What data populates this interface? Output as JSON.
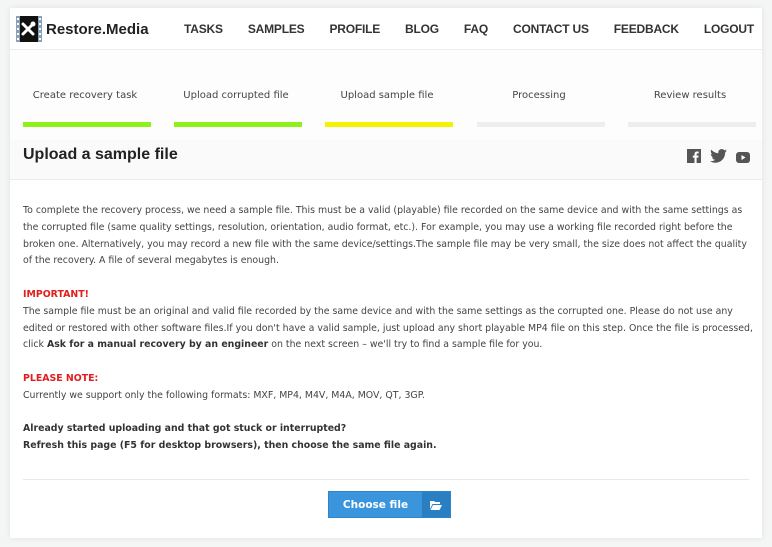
{
  "header": {
    "logo_icon": "film-tools-icon",
    "brand": "Restore.Media",
    "nav": [
      {
        "label": "TASKS"
      },
      {
        "label": "SAMPLES"
      },
      {
        "label": "PROFILE"
      },
      {
        "label": "BLOG"
      },
      {
        "label": "FAQ"
      },
      {
        "label": "CONTACT US"
      },
      {
        "label": "FEEDBACK"
      },
      {
        "label": "LOGOUT"
      }
    ]
  },
  "steps": [
    {
      "label": "Create recovery task",
      "status": "done",
      "color": "#8ef21a"
    },
    {
      "label": "Upload corrupted file",
      "status": "done",
      "color": "#8ef21a"
    },
    {
      "label": "Upload sample file",
      "status": "current",
      "color": "#f5f200"
    },
    {
      "label": "Processing",
      "status": "pending",
      "color": "#eeeeee"
    },
    {
      "label": "Review results",
      "status": "pending",
      "color": "#eeeeee"
    }
  ],
  "title_row": {
    "title": "Upload a sample file",
    "social": [
      "facebook-icon",
      "twitter-icon",
      "youtube-icon"
    ]
  },
  "content": {
    "intro": "To complete the recovery process, we need a sample file. This must be a valid (playable) file recorded on the same device and with the same settings as the corrupted file (same quality settings, resolution, orientation, audio format, etc.). For example, you may use a working file recorded right before the broken one. Alternatively, you may record a new file with the same device/settings.The sample file may be very small, the size does not affect the quality of the recovery. A file of several megabytes is enough.",
    "important_heading": "IMPORTANT!",
    "important_text_1": "The sample file must be an original and valid file recorded by the same device and with the same settings as the corrupted one. Please do not use any edited or restored with other software files.If you don't have a valid sample, just upload any short playable MP4 file on this step. Once the file is processed, click ",
    "important_bold": "Ask for a manual recovery by an engineer",
    "important_text_2": " on the next screen – we'll try to find a sample file for you.",
    "note_heading": "PLEASE NOTE:",
    "note_text": "Currently we support only the following formats: MXF, MP4, M4V, M4A, MOV, QT, 3GP.",
    "stuck_line_1": "Already started uploading and that got stuck or interrupted?",
    "stuck_line_2": "Refresh this page (F5 for desktop browsers), then choose the same file again."
  },
  "upload": {
    "button_label": "Choose file",
    "button_icon": "folder-open-icon"
  },
  "colors": {
    "accent": "#3a95dc",
    "warning": "#e21d1d",
    "done": "#8ef21a",
    "current": "#f5f200"
  }
}
